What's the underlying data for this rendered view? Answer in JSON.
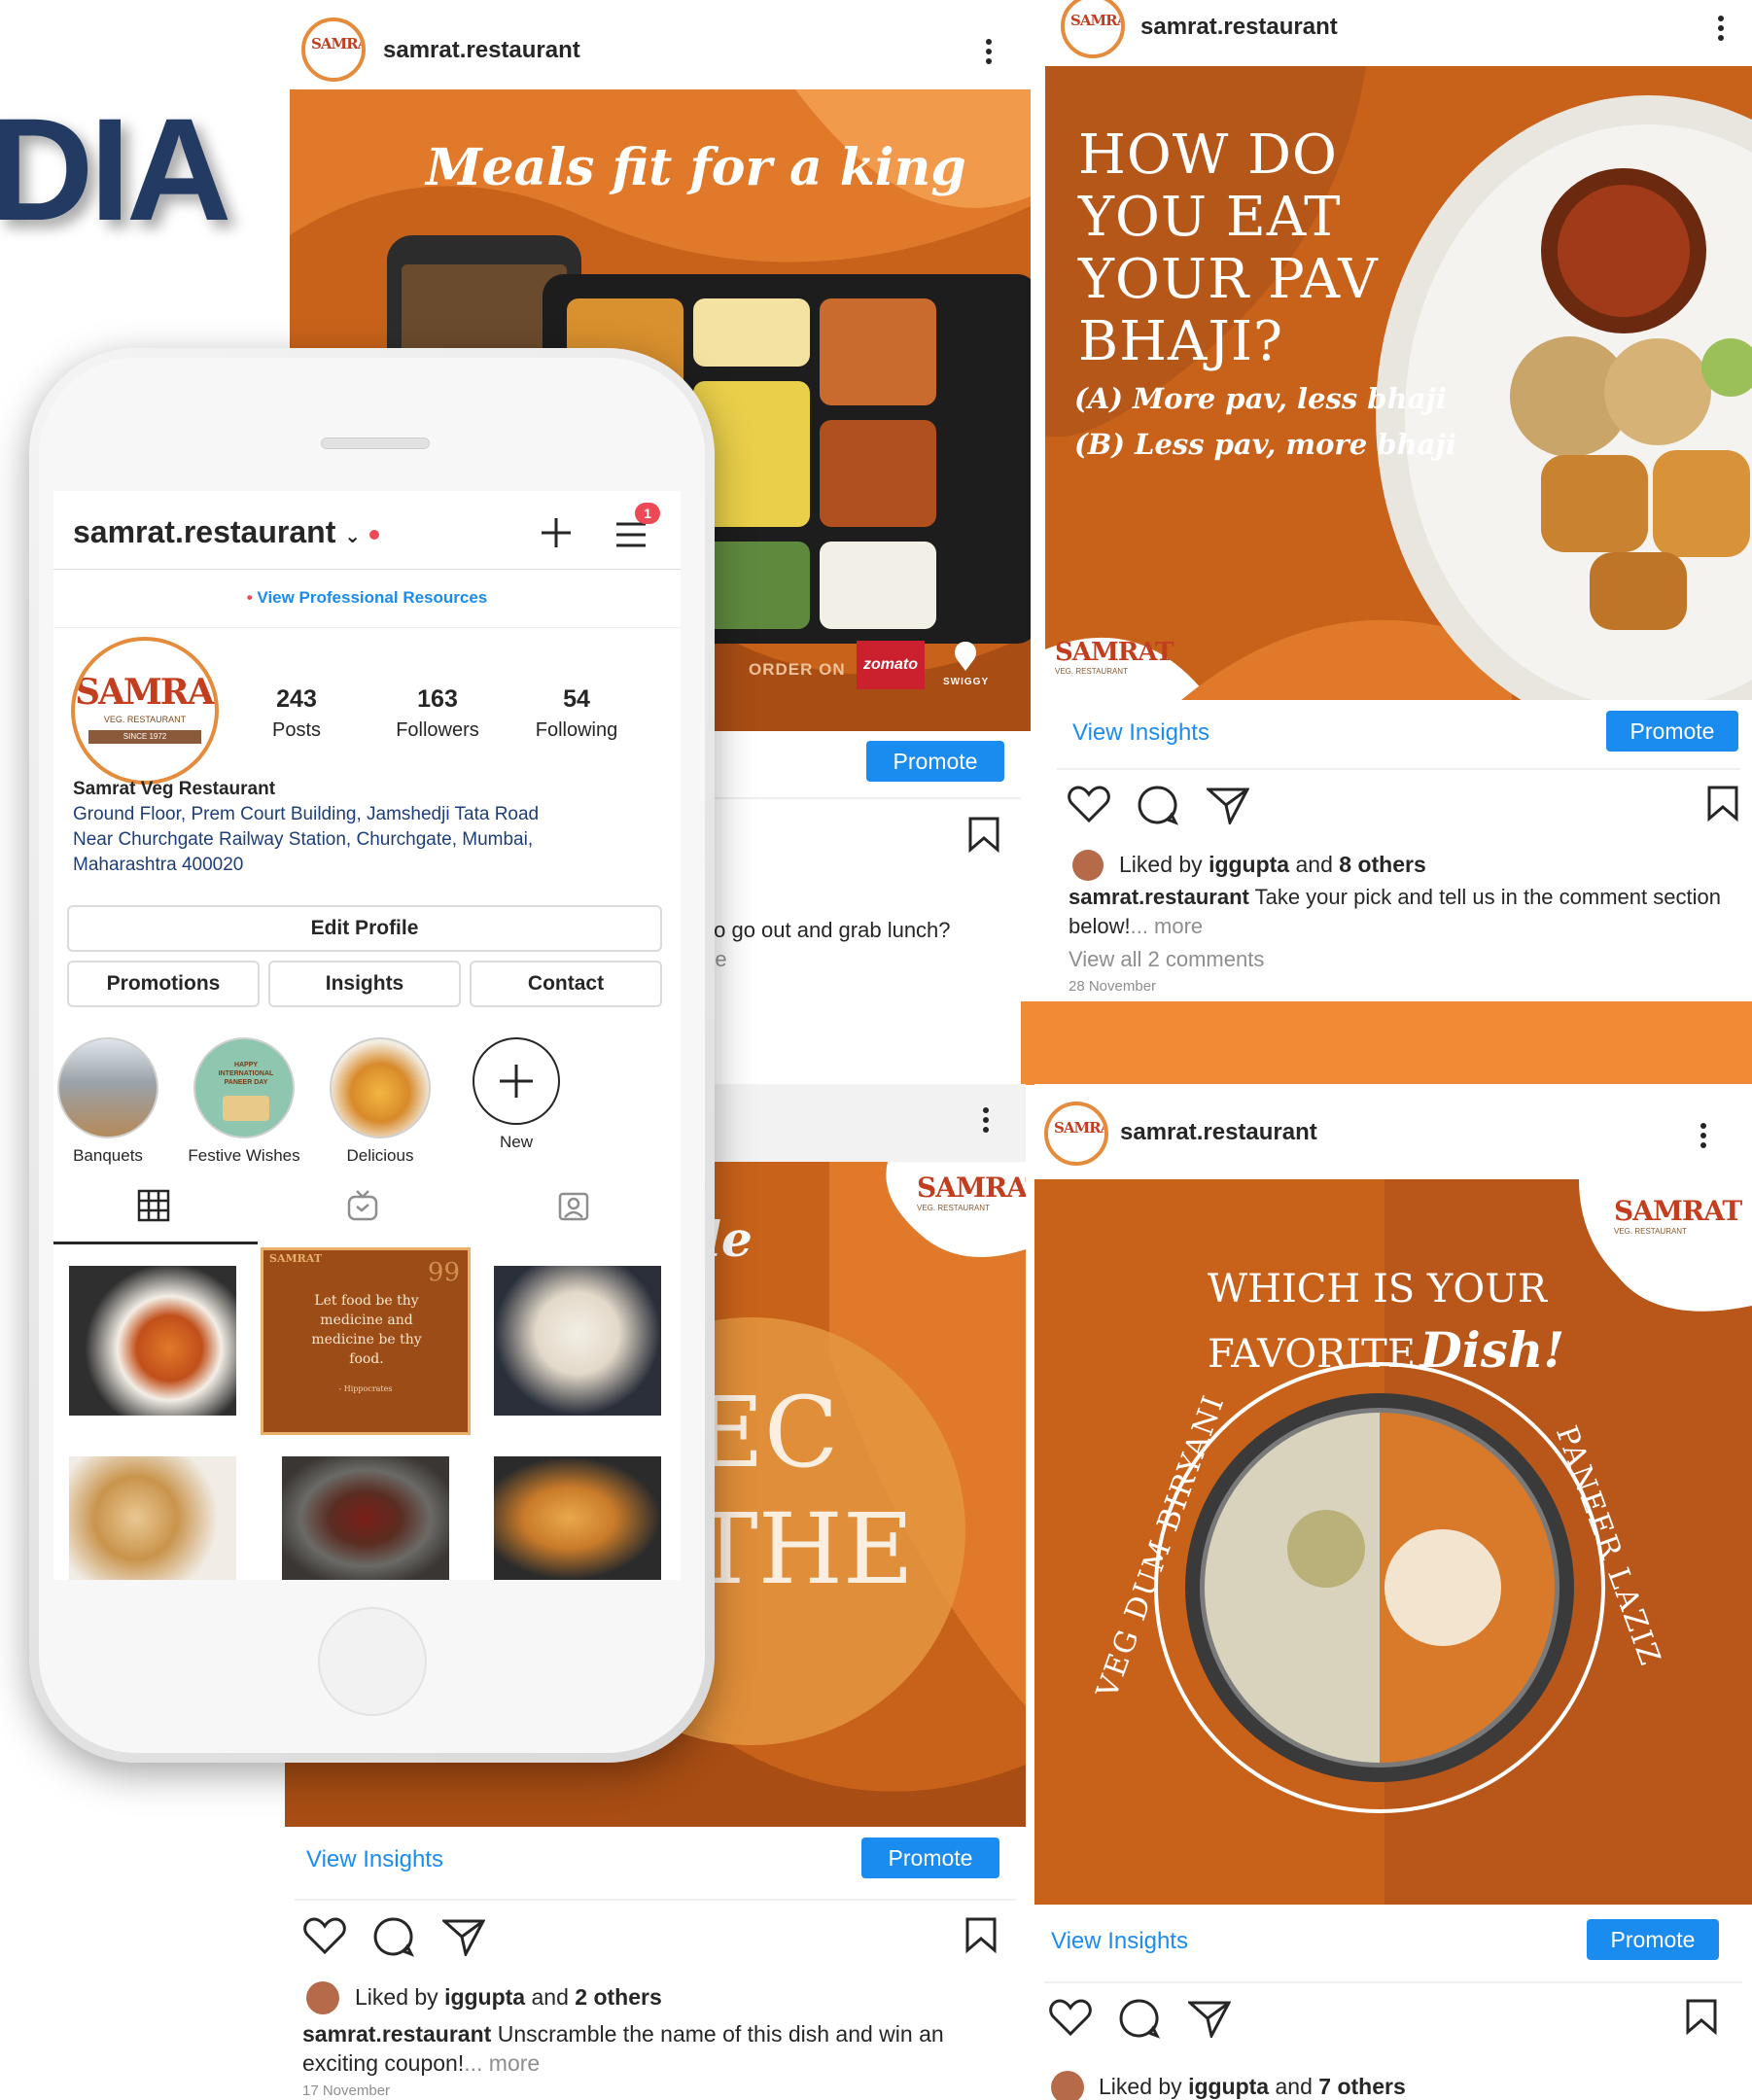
{
  "hero": {
    "text": "DIA"
  },
  "colors": {
    "brand_orange": "#c8621a",
    "accent_light_orange": "#f08a34",
    "brand_blue": "#1a8cf0",
    "heading_navy": "#233a62",
    "notification_red": "#ed4956"
  },
  "post_top_center": {
    "username": "samrat.restaurant",
    "art_title": "Meals fit for a king",
    "order_on": "ORDER ON",
    "zomato": "zomato",
    "swiggy": "SWIGGY",
    "promote": "Promote",
    "caption_partial": "to go out and grab lunch?",
    "more_partial": "re"
  },
  "post_top_right": {
    "username": "samrat.restaurant",
    "art_lines": [
      "HOW DO",
      "YOU EAT",
      "YOUR PAV",
      "BHAJI?"
    ],
    "option_a": "(A) More pav, less bhaji",
    "option_b": "(B) Less pav, more bhaji",
    "view_insights": "View Insights",
    "promote": "Promote",
    "liked_prefix": "Liked by",
    "liked_user": "iggupta",
    "liked_and": "and",
    "liked_others": "8 others",
    "caption_user": "samrat.restaurant",
    "caption_text": "Take your pick and tell us in the comment section below!",
    "more": "... more",
    "comments": "View all 2 comments",
    "date": "28 November"
  },
  "post_bottom_center": {
    "art_fragment_1": "le",
    "art_fragment_2": "EC",
    "art_fragment_3": "THE",
    "view_insights": "View Insights",
    "promote": "Promote",
    "liked_prefix": "Liked by",
    "liked_user": "iggupta",
    "liked_and": "and",
    "liked_others": "2 others",
    "caption_user": "samrat.restaurant",
    "caption_text": "Unscramble the name of this dish and win an exciting coupon!",
    "more": "... more",
    "date": "17 November"
  },
  "post_bottom_right": {
    "username": "samrat.restaurant",
    "art_line1": "WHICH IS YOUR",
    "art_line2": "FAVORITE",
    "art_dish": "Dish!",
    "arc_left": "VEG DUM BIRYANI",
    "arc_right": "PANEER LAZIZ",
    "view_insights": "View Insights",
    "promote": "Promote",
    "liked_prefix": "Liked by",
    "liked_user": "iggupta",
    "liked_and": "and",
    "liked_others": "7 others"
  },
  "logo": {
    "name": "SAMRAT",
    "sub": "VEG. RESTAURANT",
    "since": "SINCE 1972"
  },
  "phone_profile": {
    "username": "samrat.restaurant",
    "notification_count": "1",
    "pro_resources": "View Professional Resources",
    "stats": [
      {
        "value": "243",
        "label": "Posts"
      },
      {
        "value": "163",
        "label": "Followers"
      },
      {
        "value": "54",
        "label": "Following"
      }
    ],
    "bio_name": "Samrat Veg Restaurant",
    "bio_address": [
      "Ground Floor, Prem Court Building, Jamshedji Tata Road",
      "Near Churchgate Railway Station, Churchgate, Mumbai,",
      "Maharashtra 400020"
    ],
    "edit_profile": "Edit Profile",
    "actions": [
      "Promotions",
      "Insights",
      "Contact"
    ],
    "highlights": [
      "Banquets",
      "Festive Wishes",
      "Delicious",
      "New"
    ],
    "grid_quote": "Let food be thy medicine and medicine be thy food.",
    "grid_quote_author": "- Hippocrates",
    "grid_quote_num": "99",
    "festive_thumb_text": "HAPPY INTERNATIONAL PANEER DAY"
  }
}
